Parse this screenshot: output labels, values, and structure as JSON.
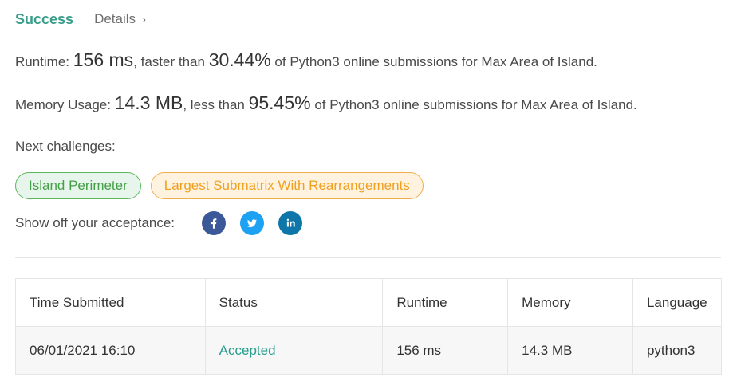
{
  "header": {
    "result": "Success",
    "details": "Details"
  },
  "runtime": {
    "label": "Runtime: ",
    "value": "156 ms",
    "mid": ", faster than ",
    "percent": "30.44%",
    "suffix": " of Python3 online submissions for Max Area of Island."
  },
  "memory": {
    "label": "Memory Usage: ",
    "value": "14.3 MB",
    "mid": ", less than ",
    "percent": "95.45%",
    "suffix": " of Python3 online submissions for Max Area of Island."
  },
  "next": {
    "label": "Next challenges:",
    "challenges": [
      {
        "title": "Island Perimeter",
        "difficulty_color": "#43a047"
      },
      {
        "title": "Largest Submatrix With Rearrangements",
        "difficulty_color": "#f0a020"
      }
    ]
  },
  "share": {
    "label": "Show off your acceptance:",
    "icons": [
      "facebook-icon",
      "twitter-icon",
      "linkedin-icon"
    ],
    "colors": {
      "facebook": "#3b5998",
      "twitter": "#1da1f2",
      "linkedin": "#0e76a8"
    }
  },
  "table": {
    "headers": [
      "Time Submitted",
      "Status",
      "Runtime",
      "Memory",
      "Language"
    ],
    "rows": [
      {
        "time": "06/01/2021 16:10",
        "status": "Accepted",
        "runtime": "156 ms",
        "memory": "14.3 MB",
        "language": "python3"
      }
    ]
  },
  "colors": {
    "accent": "#3a9e8a",
    "accepted": "#2a9d8f"
  }
}
